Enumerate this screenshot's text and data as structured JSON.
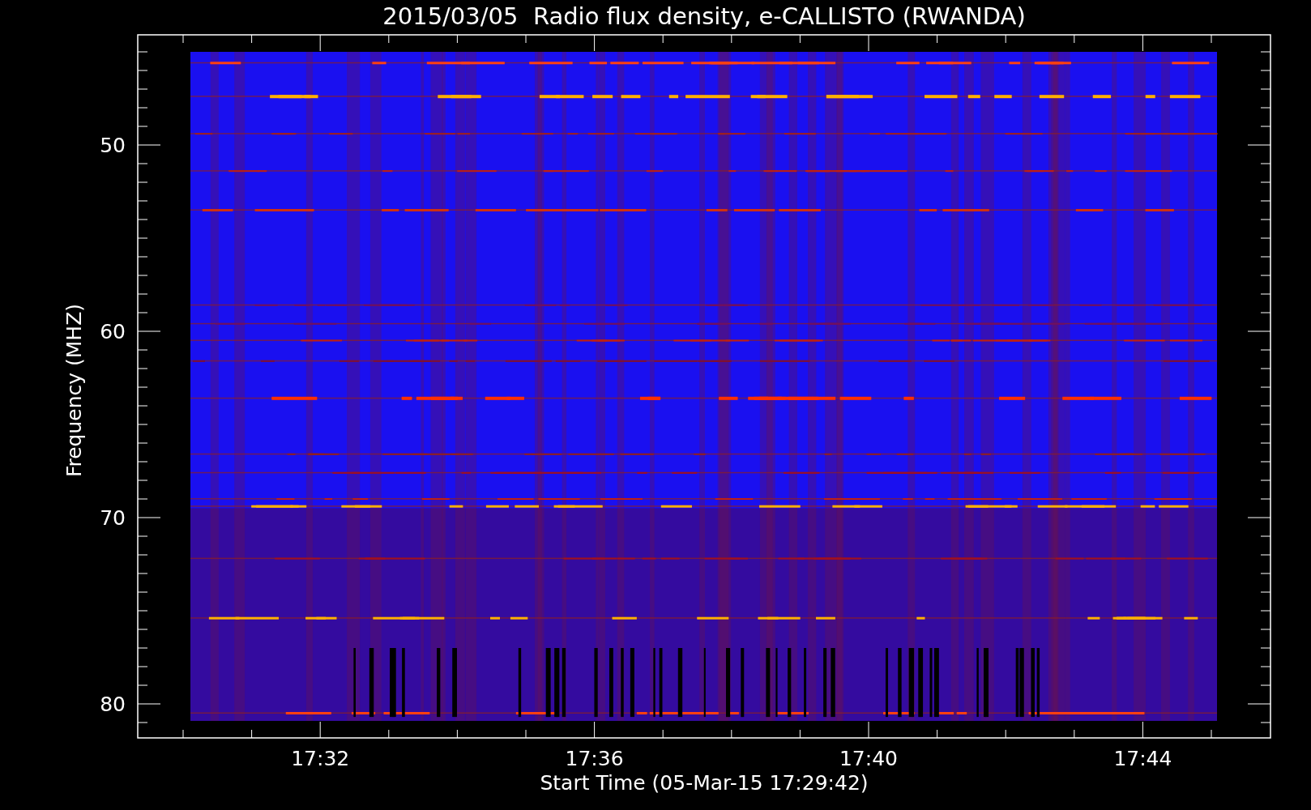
{
  "title": "2015/03/05  Radio flux density, e-CALLISTO (RWANDA)",
  "y_axis": {
    "label": "Frequency (MHZ)",
    "ticks": [
      "50",
      "60",
      "70",
      "80"
    ]
  },
  "x_axis": {
    "label": "Start Time (05-Mar-15 17:29:42)",
    "ticks": [
      "17:32",
      "17:36",
      "17:40",
      "17:44"
    ]
  }
}
